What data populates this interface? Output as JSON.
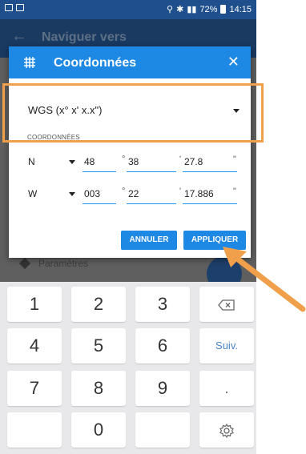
{
  "status_bar": {
    "battery_percent": "72%",
    "time": "14:15"
  },
  "background_app": {
    "title": "Naviguer vers",
    "settings_row": "Paramètres"
  },
  "dialog": {
    "title": "Coordonnées",
    "format_value": "WGS (x° x' x.x\")",
    "section_label": "COORDONNÉES",
    "rows": [
      {
        "hemisphere": "N",
        "degrees": "48",
        "minutes": "38",
        "seconds": "27.8"
      },
      {
        "hemisphere": "W",
        "degrees": "003",
        "minutes": "22",
        "seconds": "17.886"
      }
    ],
    "separators": {
      "degree": "°",
      "minute": "'",
      "second": "\""
    },
    "cancel_label": "ANNULER",
    "apply_label": "APPLIQUER"
  },
  "keyboard": {
    "keys": [
      "1",
      "2",
      "3",
      "4",
      "5",
      "6",
      "7",
      "8",
      "9",
      "0"
    ],
    "next_label": "Suiv.",
    "dot_label": "."
  },
  "colors": {
    "accent": "#1e88e5",
    "annotation": "#f0a04b"
  }
}
